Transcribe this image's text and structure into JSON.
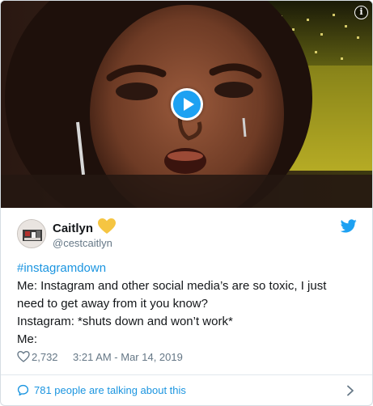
{
  "tweet": {
    "author_name": "Caitlyn",
    "author_emoji": "yellow-heart",
    "handle": "@cestcaitlyn",
    "text_lines": [
      "#instagramdown",
      "Me: Instagram and other social media’s are so toxic, I just",
      "need to get away from it you know?",
      "Instagram: *shuts down and won’t work*",
      "Me:"
    ],
    "likes": "2,732",
    "timestamp": "3:21 AM - Mar 14, 2019",
    "talking": "781 people are talking about this"
  },
  "media": {
    "type": "gif",
    "controls": [
      "play-icon",
      "info-icon"
    ]
  },
  "colors": {
    "accent": "#1da1f2",
    "link": "#1b95e0",
    "muted": "#657786",
    "emoji_heart": "#f5c542"
  }
}
